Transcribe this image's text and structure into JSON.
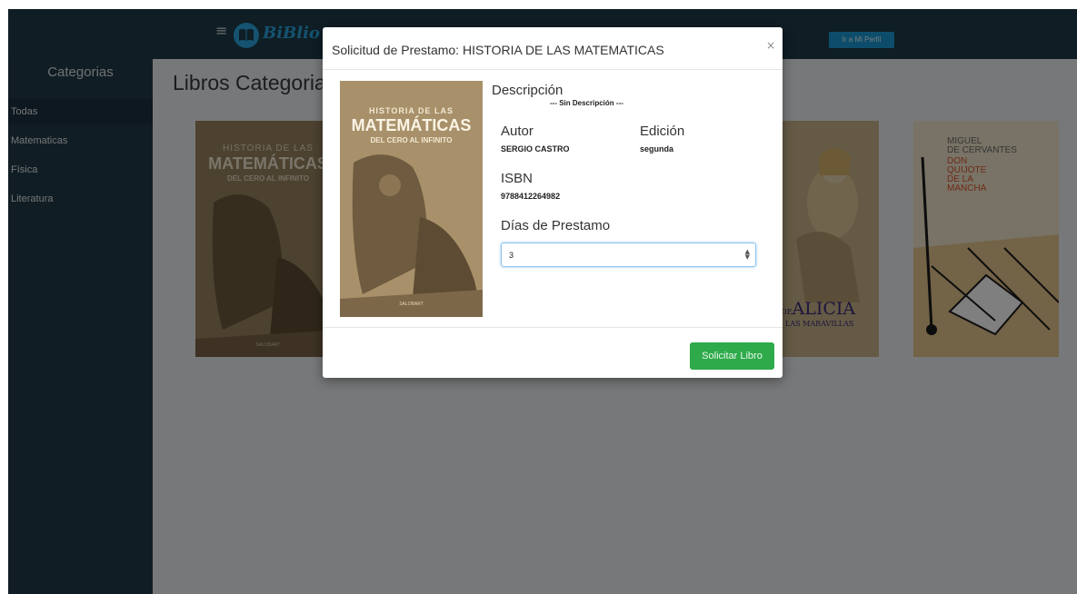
{
  "header": {
    "logo_text": "BiBlio",
    "profile_button": "Ir a Mi Perfil"
  },
  "sidebar": {
    "title": "Categorias",
    "items": [
      {
        "label": "Todas",
        "active": true
      },
      {
        "label": "Matematicas",
        "active": false
      },
      {
        "label": "Física",
        "active": false
      },
      {
        "label": "Literatura",
        "active": false
      }
    ]
  },
  "main": {
    "title": "Libros Categorias"
  },
  "books": [
    {
      "cover_line1": "HISTORIA DE LAS",
      "cover_line2": "MATEMÁTICAS",
      "cover_line3": "DEL CERO AL INFINITO",
      "publisher": "SALOBART"
    },
    {
      "cover_title_small": "...RAS DE",
      "cover_title_big": "ALICIA",
      "cover_sub": "...S DE LAS MARAVILLAS"
    },
    {
      "author_line1": "MIGUEL",
      "author_line2": "DE CERVANTES",
      "title_line1": "DON",
      "title_line2": "QUIJOTE",
      "title_line3": "DE LA",
      "title_line4": "MANCHA"
    }
  ],
  "modal": {
    "title": "Solicitud de Prestamo: HISTORIA DE LAS MATEMATICAS",
    "close": "×",
    "description_label": "Descripción",
    "description_value": "--- Sin Descripción ---",
    "author_label": "Autor",
    "author_value": "SERGIO CASTRO",
    "edition_label": "Edición",
    "edition_value": "segunda",
    "isbn_label": "ISBN",
    "isbn_value": "9788412264982",
    "days_label": "Días de Prestamo",
    "days_value": "3",
    "submit_button": "Solicitar Libro"
  },
  "colors": {
    "topbar": "#1f3a48",
    "sidebar": "#223b48",
    "accent_blue": "#1b9bd7",
    "submit_green": "#2eaa4a"
  }
}
